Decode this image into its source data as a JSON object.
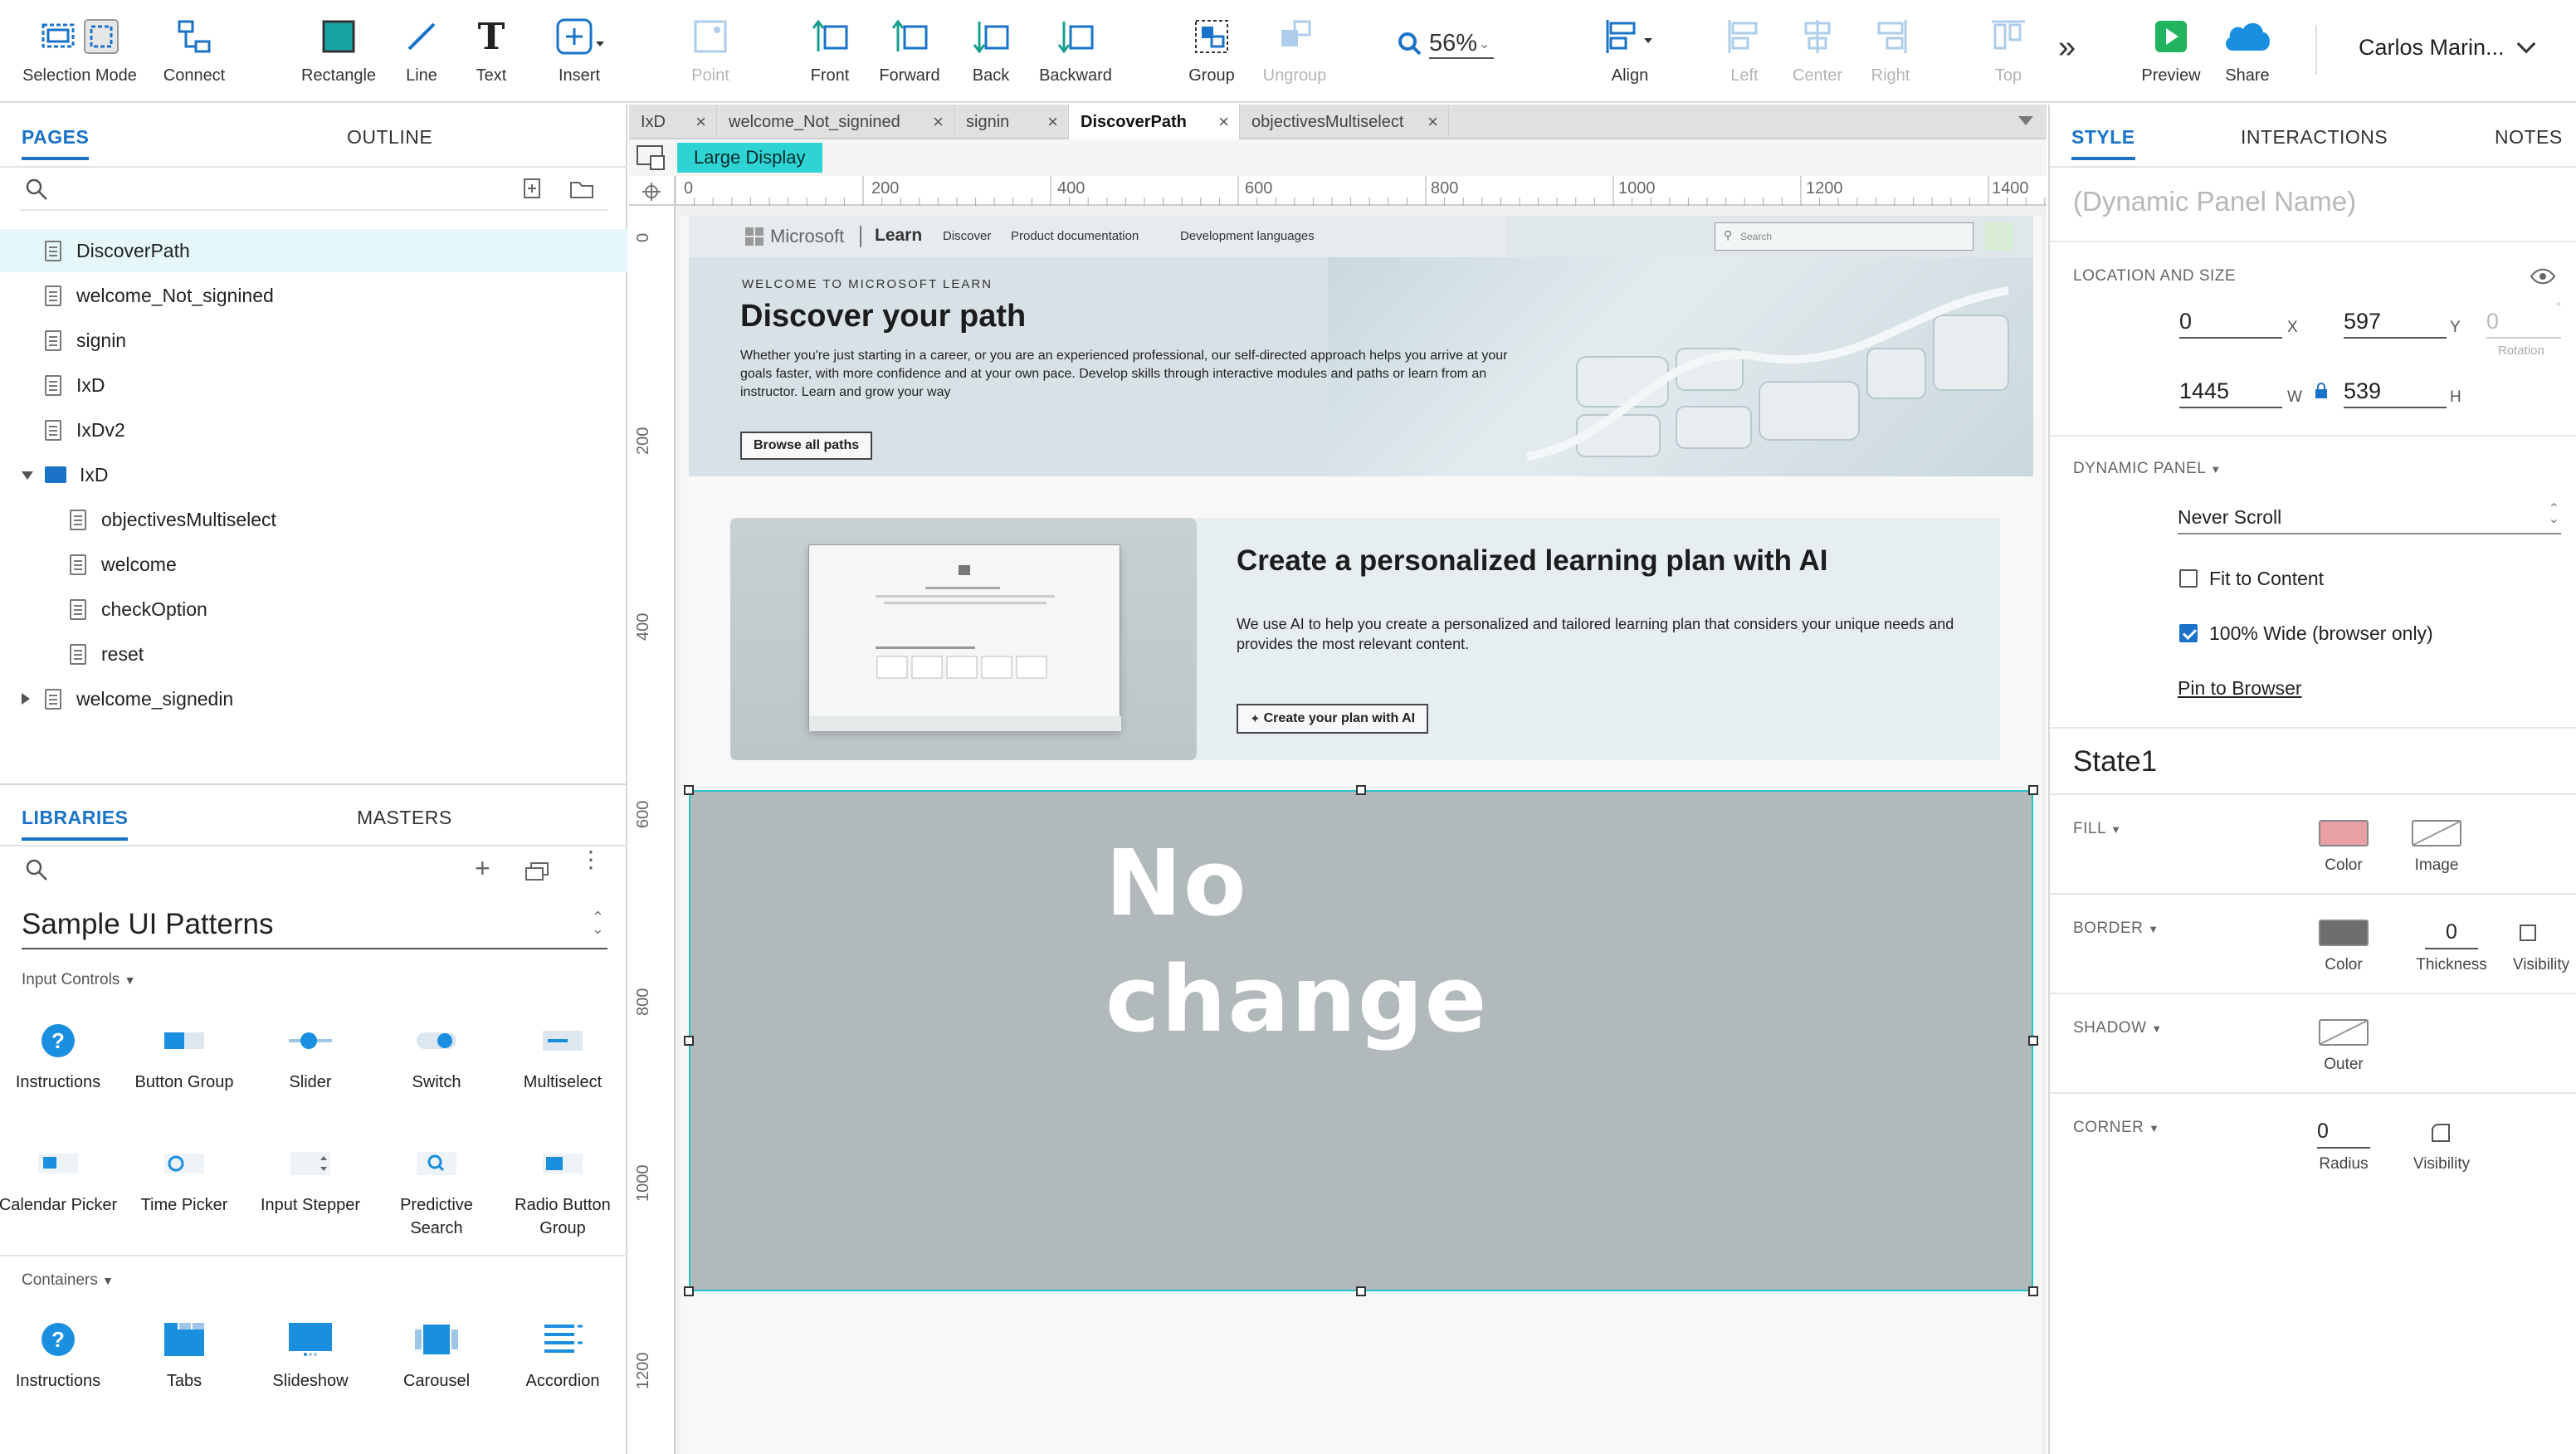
{
  "toolbar": {
    "selection_mode": "Selection Mode",
    "connect": "Connect",
    "rectangle": "Rectangle",
    "line": "Line",
    "text": "Text",
    "insert": "Insert",
    "point": "Point",
    "front": "Front",
    "forward": "Forward",
    "back": "Back",
    "backward": "Backward",
    "group": "Group",
    "ungroup": "Ungroup",
    "zoom": "56%",
    "align": "Align",
    "left": "Left",
    "center": "Center",
    "right": "Right",
    "top": "Top",
    "preview": "Preview",
    "share": "Share",
    "user": "Carlos Marin..."
  },
  "pages_panel": {
    "tab_pages": "PAGES",
    "tab_outline": "OUTLINE",
    "items": [
      {
        "label": "DiscoverPath"
      },
      {
        "label": "welcome_Not_signined"
      },
      {
        "label": "signin"
      },
      {
        "label": "IxD"
      },
      {
        "label": "IxDv2"
      },
      {
        "label": "IxD"
      },
      {
        "label": "objectivesMultiselect"
      },
      {
        "label": "welcome"
      },
      {
        "label": "checkOption"
      },
      {
        "label": "reset"
      },
      {
        "label": "welcome_signedin"
      }
    ]
  },
  "libraries_panel": {
    "tab_libraries": "LIBRARIES",
    "tab_masters": "MASTERS",
    "library_name": "Sample UI Patterns",
    "section_input": "Input Controls",
    "section_containers": "Containers",
    "input_widgets": [
      {
        "label": "Instructions"
      },
      {
        "label": "Button Group"
      },
      {
        "label": "Slider"
      },
      {
        "label": "Switch"
      },
      {
        "label": "Multiselect"
      },
      {
        "label": "Calendar Picker"
      },
      {
        "label": "Time Picker"
      },
      {
        "label": "Input Stepper"
      },
      {
        "label": "Predictive Search"
      },
      {
        "label": "Radio Button Group"
      }
    ],
    "container_widgets": [
      {
        "label": "Instructions"
      },
      {
        "label": "Tabs"
      },
      {
        "label": "Slideshow"
      },
      {
        "label": "Carousel"
      },
      {
        "label": "Accordion"
      }
    ]
  },
  "doc_tabs": [
    {
      "label": "IxD"
    },
    {
      "label": "welcome_Not_signined"
    },
    {
      "label": "signin"
    },
    {
      "label": "DiscoverPath"
    },
    {
      "label": "objectivesMultiselect"
    }
  ],
  "canvas": {
    "adaptive_view": "Large Display",
    "h_ruler": [
      "0",
      "200",
      "400",
      "600",
      "800",
      "1000",
      "1200",
      "1400"
    ],
    "v_ruler": [
      "0",
      "200",
      "400",
      "600",
      "800",
      "1000",
      "1200"
    ],
    "ms_brand": "Microsoft",
    "ms_learn": "Learn",
    "nav": [
      "Discover",
      "Product documentation",
      "Development languages"
    ],
    "search_placeholder": "Search",
    "hero_eyebrow": "WELCOME TO MICROSOFT LEARN",
    "hero_title": "Discover your path",
    "hero_body": "Whether you're just starting in a career, or you are an experienced professional, our self-directed approach helps you arrive at your goals faster, with more confidence and at your own pace. Develop skills through interactive modules and paths or learn from an instructor. Learn and grow your way",
    "hero_button": "Browse all paths",
    "plan_title": "Create a personalized learning plan with AI",
    "plan_body": "We use AI to help you create a personalized and tailored learning plan that considers your unique needs and provides the most relevant content.",
    "plan_button": "Create your plan with AI",
    "dynamic_panel_text_1": "No",
    "dynamic_panel_text_2": "change"
  },
  "style_panel": {
    "tab_style": "STYLE",
    "tab_interactions": "INTERACTIONS",
    "tab_notes": "NOTES",
    "name_placeholder": "(Dynamic Panel Name)",
    "location_label": "LOCATION AND SIZE",
    "x": "0",
    "y": "597",
    "rotation": "0",
    "rotation_label": "Rotation",
    "w": "1445",
    "h": "539",
    "x_unit": "X",
    "y_unit": "Y",
    "w_unit": "W",
    "h_unit": "H",
    "dp_label": "DYNAMIC PANEL",
    "scroll_value": "Never Scroll",
    "fit_to_content": "Fit to Content",
    "wide_browser": "100% Wide (browser only)",
    "pin_to_browser": "Pin to Browser",
    "state_name": "State1",
    "fill_label": "FILL",
    "color_label": "Color",
    "image_label": "Image",
    "border_label": "BORDER",
    "border_thickness": "0",
    "thickness_label": "Thickness",
    "visibility_label": "Visibility",
    "shadow_label": "SHADOW",
    "outer_label": "Outer",
    "corner_label": "CORNER",
    "radius_value": "0",
    "radius_label": "Radius",
    "fill_color": "#e8a0a4",
    "border_color": "#6d6d6d"
  }
}
